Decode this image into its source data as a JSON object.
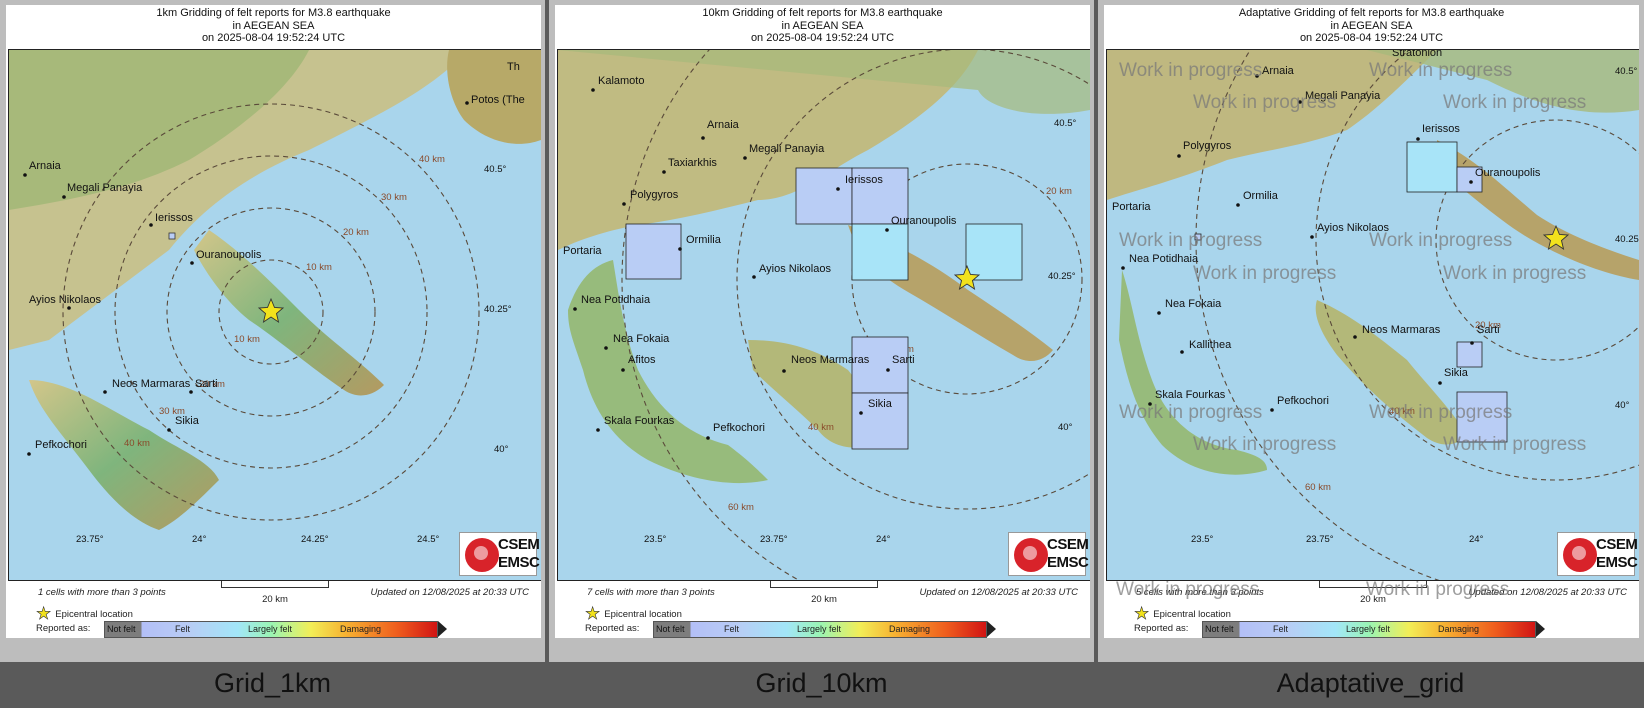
{
  "panels": [
    {
      "id": "grid-1km",
      "title": [
        "1km Gridding of felt reports for M3.8 earthquake",
        "in AEGEAN SEA",
        "on  2025-08-04 19:52:24 UTC"
      ],
      "cells_note": "1 cells with more than 3 points",
      "caption": "Grid_1km",
      "places": [
        "Arnaia",
        "Megali Panayia",
        "Ierissos",
        "Ouranoupolis",
        "Ayios Nikolaos",
        "Neos Marmaras",
        "Sarti",
        "Sikia",
        "Pefkochori",
        "Potos (The",
        "Th"
      ],
      "rings": [
        "10 km",
        "10 km",
        "20 km",
        "20 km",
        "30 km",
        "30 km",
        "40 km",
        "40 km"
      ],
      "lon_ticks": [
        "23.75°",
        "24°",
        "24.25°",
        "24.5°"
      ],
      "lat_ticks": [
        "40.5°",
        "40.25°",
        "40°"
      ]
    },
    {
      "id": "grid-10km",
      "title": [
        "10km Gridding of felt reports for M3.8 earthquake",
        "in AEGEAN SEA",
        "on  2025-08-04 19:52:24 UTC"
      ],
      "cells_note": "7 cells with more than 3 points",
      "caption": "Grid_10km",
      "places": [
        "Kalamoto",
        "Arnaia",
        "Megali Panayia",
        "Taxiarkhis",
        "Polygyros",
        "Ierissos",
        "Ouranoupolis",
        "Ormilia",
        "Portaria",
        "Ayios Nikolaos",
        "Nea Potidhaia",
        "Nea Fokaia",
        "Afitos",
        "Neos Marmaras",
        "Sarti",
        "Sikia",
        "Skala Fourkas",
        "Pefkochori"
      ],
      "rings": [
        "20 km",
        "20 km",
        "40 km",
        "60 km"
      ],
      "lon_ticks": [
        "23.5°",
        "23.75°",
        "24°"
      ],
      "lat_ticks": [
        "40.5°",
        "40.25°",
        "40°"
      ]
    },
    {
      "id": "adaptative-grid",
      "title": [
        "Adaptative Gridding of felt reports for M3.8 earthquake",
        "in AEGEAN SEA",
        "on  2025-08-04 19:52:24 UTC"
      ],
      "cells_note": "5 cells with more than 3 points",
      "caption": "Adaptative_grid",
      "places": [
        "Stratonion",
        "Arnaia",
        "Megali Panayia",
        "Ierissos",
        "Ouranoupolis",
        "Polygyros",
        "Ormilia",
        "Portaria",
        "Ayios Nikolaos",
        "Nea Potidhaia",
        "Nea Fokaia",
        "Kallithea",
        "Neos Marmaras",
        "Sarti",
        "Sikia",
        "Skala Fourkas",
        "Pefkochori"
      ],
      "rings": [
        "20 km",
        "40 km",
        "60 km"
      ],
      "lon_ticks": [
        "23.5°",
        "23.75°",
        "24°"
      ],
      "lat_ticks": [
        "40.5°",
        "40.25°",
        "40°"
      ],
      "watermark": "Work in progress"
    }
  ],
  "common": {
    "scale_label": "20 km",
    "updated": "Updated on 12/08/2025 at 20:33 UTC",
    "epicentral_label": "Epicentral location",
    "reported_as": "Reported as:",
    "colorbar": [
      "Not felt",
      "Felt",
      "Largely felt",
      "Damaging"
    ],
    "logo": [
      "CSEM",
      "EMSC"
    ]
  },
  "colors": {
    "sea": "#a9d5ec",
    "land_low": "#6fb07a",
    "land_mid": "#d3c68a",
    "land_high": "#8a5a2c",
    "cell_felt": "#b9cdf5",
    "cell_felt_strong": "#a8e4f8",
    "epicenter": "#f2e21c",
    "ring": "#5a4a3a"
  }
}
